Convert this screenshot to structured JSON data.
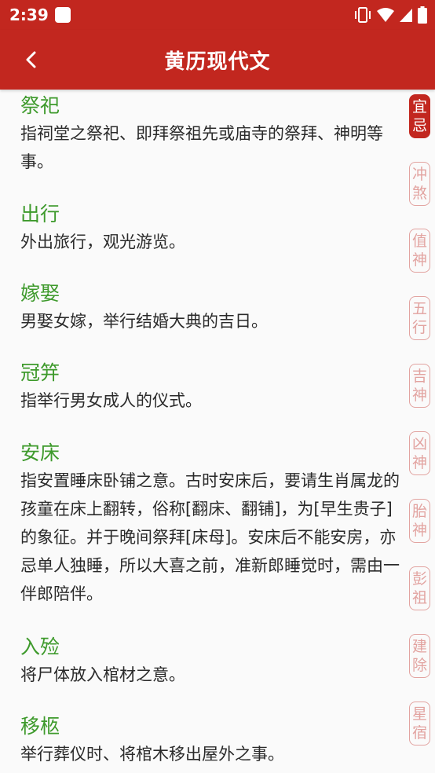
{
  "status_bar": {
    "time": "2:39",
    "icons": [
      "app-notification-icon",
      "vibrate-icon",
      "wifi-icon",
      "signal-icon",
      "battery-icon"
    ]
  },
  "app_bar": {
    "title": "黄历现代文",
    "back_icon": "chevron-left-icon"
  },
  "entries": [
    {
      "title": "祭祀",
      "desc": "指祠堂之祭祀、即拜祭祖先或庙寺的祭拜、神明等事。"
    },
    {
      "title": "出行",
      "desc": "外出旅行，观光游览。"
    },
    {
      "title": "嫁娶",
      "desc": "男娶女嫁，举行结婚大典的吉日。"
    },
    {
      "title": "冠笄",
      "desc": "指举行男女成人的仪式。"
    },
    {
      "title": "安床",
      "desc": "指安置睡床卧铺之意。古时安床后，要请生肖属龙的孩童在床上翻转，俗称[翻床、翻铺]，为[早生贵子]的象征。并于晚间祭拜[床母]。安床后不能安房，亦忌单人独睡，所以大喜之前，准新郎睡觉时，需由一伴郎陪伴。"
    },
    {
      "title": "入殓",
      "desc": "将尸体放入棺材之意。"
    },
    {
      "title": "移柩",
      "desc": "举行葬仪时、将棺木移出屋外之事。"
    }
  ],
  "side_tabs": [
    {
      "top": "宜",
      "bottom": "忌",
      "active": true
    },
    {
      "top": "冲",
      "bottom": "煞",
      "active": false
    },
    {
      "top": "值",
      "bottom": "神",
      "active": false
    },
    {
      "top": "五",
      "bottom": "行",
      "active": false
    },
    {
      "top": "吉",
      "bottom": "神",
      "active": false
    },
    {
      "top": "凶",
      "bottom": "神",
      "active": false
    },
    {
      "top": "胎",
      "bottom": "神",
      "active": false
    },
    {
      "top": "彭",
      "bottom": "祖",
      "active": false
    },
    {
      "top": "建",
      "bottom": "除",
      "active": false
    },
    {
      "top": "星",
      "bottom": "宿",
      "active": false
    }
  ],
  "colors": {
    "brand_red": "#c2271f",
    "entry_title_green": "#3e9a2c",
    "tab_outline_pink": "#e2a3a0"
  }
}
